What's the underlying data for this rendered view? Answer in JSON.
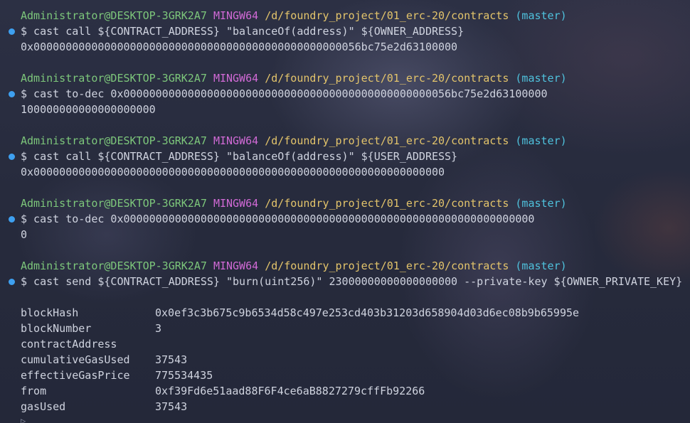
{
  "colors": {
    "background": "#262a3d",
    "user": "#7dc77b",
    "shell": "#d16ad6",
    "path": "#e3c46b",
    "branch": "#4fc2dd",
    "text": "#cfd3df",
    "indicator_dot": "#3ea0f0"
  },
  "prompt": {
    "user_host": "Administrator@DESKTOP-3GRK2A7",
    "shell": "MINGW64",
    "path": "/d/foundry_project/01_erc-20/contracts",
    "branch": "(master)"
  },
  "commands": [
    {
      "command": "$ cast call ${CONTRACT_ADDRESS} \"balanceOf(address)\" ${OWNER_ADDRESS}",
      "output": "0x000000000000000000000000000000000000000000000000056bc75e2d63100000"
    },
    {
      "command": "$ cast to-dec 0x000000000000000000000000000000000000000000000000056bc75e2d63100000",
      "output": "100000000000000000000"
    },
    {
      "command": "$ cast call ${CONTRACT_ADDRESS} \"balanceOf(address)\" ${USER_ADDRESS}",
      "output": "0x0000000000000000000000000000000000000000000000000000000000000000"
    },
    {
      "command": "$ cast to-dec 0x0000000000000000000000000000000000000000000000000000000000000000",
      "output": "0"
    },
    {
      "command": "$ cast send ${CONTRACT_ADDRESS} \"burn(uint256)\" 23000000000000000000 --private-key ${OWNER_PRIVATE_KEY}",
      "output": ""
    }
  ],
  "receipt": [
    {
      "key": "blockHash",
      "value": "0x0ef3c3b675c9b6534d58c497e253cd403b31203d658904d03d6ec08b9b65995e"
    },
    {
      "key": "blockNumber",
      "value": "3"
    },
    {
      "key": "contractAddress",
      "value": ""
    },
    {
      "key": "cumulativeGasUsed",
      "value": "37543"
    },
    {
      "key": "effectiveGasPrice",
      "value": "775534435"
    },
    {
      "key": "from",
      "value": "0xf39Fd6e51aad88F6F4ce6aB8827279cffFb92266"
    },
    {
      "key": "gasUsed",
      "value": "37543"
    }
  ],
  "scroll_indicator": "▷"
}
